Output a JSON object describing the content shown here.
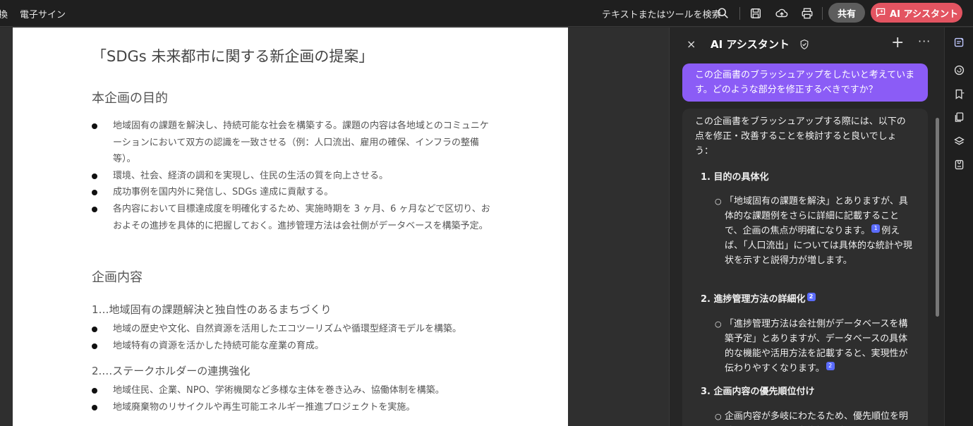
{
  "topbar": {
    "menu_left": "換",
    "menu_esign": "電子サイン",
    "search_label": "テキストまたはツールを検索",
    "share_label": "共有",
    "ai_button_label": "AI アシスタント"
  },
  "document": {
    "title": "「SDGs 未来都市に関する新企画の提案」",
    "section1_heading": "本企画の目的",
    "purpose_bullets": [
      "地域固有の課題を解決し、持続可能な社会を構築する。課題の内容は各地域とのコミュニケーションにおいて双方の認識を一致させる（例：人口流出、雇用の確保、インフラの整備等）。",
      "環境、社会、経済の調和を実現し、住民の生活の質を向上させる。",
      "成功事例を国内外に発信し、SDGs 達成に貢献する。",
      "各内容において目標達成度を明確化するため、実施時期を 3 ヶ月、6 ヶ月などで区切り、おおよその進捗を具体的に把握しておく。進捗管理方法は会社側がデータベースを構築予定。"
    ],
    "section2_heading": "企画内容",
    "sub1_heading": "1…地域固有の課題解決と独自性のあるまちづくり",
    "sub1_bullets": [
      "地域の歴史や文化、自然資源を活用したエコツーリズムや循環型経済モデルを構築。",
      "地域特有の資源を活かした持続可能な産業の育成。"
    ],
    "sub2_heading": "2.…ステークホルダーの連携強化",
    "sub2_bullets": [
      "地域住民、企業、NPO、学術機関など多様な主体を巻き込み、協働体制を構築。",
      "地域廃棄物のリサイクルや再生可能エネルギー推進プロジェクトを実施。"
    ]
  },
  "panel": {
    "close": "×",
    "title": "AI アシスタント",
    "plus": "+",
    "more": "···",
    "user_message": "この企画書のブラッシュアップをしたいと考えています。どのような部分を修正するべきですか？",
    "ai_intro": "この企画書をブラッシュアップする際には、以下の点を修正・改善することを検討すると良いでしょう：",
    "items": [
      {
        "num": "1.",
        "heading": "目的の具体化",
        "ref": "",
        "detail_a": "「地域固有の課題を解決」とありますが、具体的な課題例をさらに詳細に記載することで、企画の焦点が明確になります。",
        "detail_ref": "1",
        "detail_b": "例えば、「人口流出」については具体的な統計や現状を示すと説得力が増します。"
      },
      {
        "num": "2.",
        "heading": "進捗管理方法の詳細化",
        "ref": "2",
        "detail_a": "「進捗管理方法は会社側がデータベースを構築予定」とありますが、データベースの具体的な機能や活用方法を記載すると、実現性が伝わりやすくなります。",
        "detail_ref": "2",
        "detail_b": ""
      },
      {
        "num": "3.",
        "heading": "企画内容の優先順位付け",
        "ref": "",
        "detail_a": "企画内容が多岐にわたるため、優先順位を明確にすることで、実施計画がより具",
        "detail_ref": "",
        "detail_b": ""
      }
    ]
  }
}
